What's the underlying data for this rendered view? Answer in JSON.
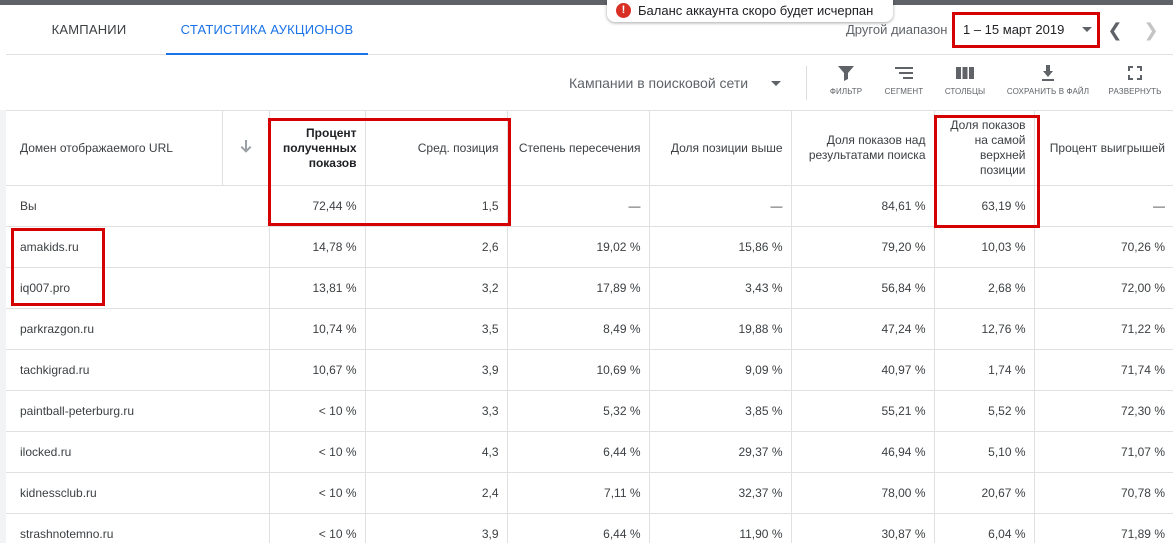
{
  "tabs": [
    {
      "label": "КАМПАНИИ",
      "active": false
    },
    {
      "label": "СТАТИСТИКА АУКЦИОНОВ",
      "active": true
    }
  ],
  "notice": {
    "icon": "error-icon",
    "text": "Баланс аккаунта скоро будет исчерпан"
  },
  "date_range": {
    "label": "Другой диапазон",
    "value": "1 – 15 март 2019"
  },
  "toolbar": {
    "campaign_filter": "Кампании в поисковой сети",
    "tools": [
      {
        "icon": "filter-icon",
        "label": "ФИЛЬТР"
      },
      {
        "icon": "segment-icon",
        "label": "СЕГМЕНТ"
      },
      {
        "icon": "columns-icon",
        "label": "СТОЛБЦЫ"
      },
      {
        "icon": "download-icon",
        "label": "СОХРАНИТЬ В ФАЙЛ"
      },
      {
        "icon": "expand-icon",
        "label": "РАЗВЕРНУТЬ"
      }
    ]
  },
  "colors": {
    "accent": "#1a73e8",
    "highlight": "#d50000",
    "error": "#d93025"
  },
  "table": {
    "columns": [
      "Домен отображаемого URL",
      "",
      "Процент полученных показов",
      "Сред. позиция",
      "Степень пересечения",
      "Доля позиции выше",
      "Доля показов над результатами поиска",
      "Доля показов на самой верхней позиции",
      "Процент выигрышей"
    ],
    "rows": [
      [
        "Вы",
        "72,44 %",
        "1,5",
        "—",
        "—",
        "84,61 %",
        "63,19 %",
        "—"
      ],
      [
        "amakids.ru",
        "14,78 %",
        "2,6",
        "19,02 %",
        "15,86 %",
        "79,20 %",
        "10,03 %",
        "70,26 %"
      ],
      [
        "iq007.pro",
        "13,81 %",
        "3,2",
        "17,89 %",
        "3,43 %",
        "56,84 %",
        "2,68 %",
        "72,00 %"
      ],
      [
        "parkrazgon.ru",
        "10,74 %",
        "3,5",
        "8,49 %",
        "19,88 %",
        "47,24 %",
        "12,76 %",
        "71,22 %"
      ],
      [
        "tachkigrad.ru",
        "10,67 %",
        "3,9",
        "10,69 %",
        "9,09 %",
        "40,97 %",
        "1,74 %",
        "71,74 %"
      ],
      [
        "paintball-peterburg.ru",
        "< 10 %",
        "3,3",
        "5,32 %",
        "3,85 %",
        "55,21 %",
        "5,52 %",
        "72,30 %"
      ],
      [
        "ilocked.ru",
        "< 10 %",
        "4,3",
        "6,44 %",
        "29,37 %",
        "46,94 %",
        "5,10 %",
        "71,07 %"
      ],
      [
        "kidnessclub.ru",
        "< 10 %",
        "2,4",
        "7,11 %",
        "32,37 %",
        "78,00 %",
        "20,67 %",
        "70,78 %"
      ],
      [
        "strashnotemno.ru",
        "< 10 %",
        "3,9",
        "6,44 %",
        "11,90 %",
        "30,87 %",
        "6,04 %",
        "71,89 %"
      ]
    ]
  }
}
